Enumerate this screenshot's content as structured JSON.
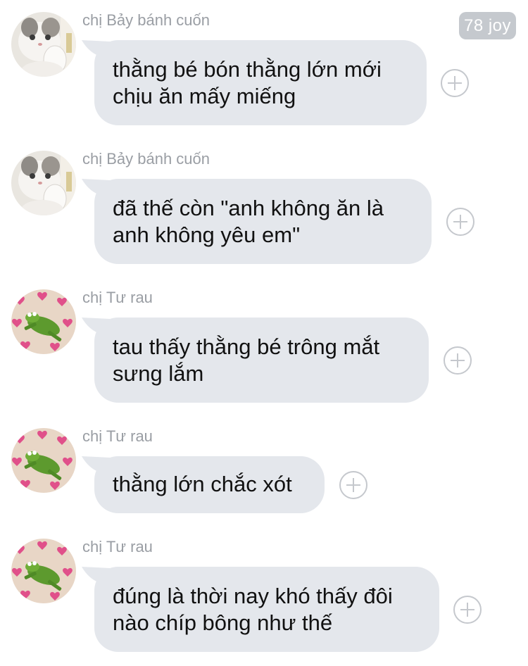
{
  "header": {
    "badge": "78 joy"
  },
  "colors": {
    "bubble": "#e4e7ec",
    "sender": "#9a9ea4",
    "badge": "#c5c9ce",
    "text": "#111111"
  },
  "messages": [
    {
      "sender": "chị Bảy bánh cuốn",
      "avatar": "cat-avatar",
      "lines": [
        "thằng bé bón thằng lớn mới",
        "chịu ăn mấy miếng"
      ]
    },
    {
      "sender": "chị Bảy bánh cuốn",
      "avatar": "cat-avatar",
      "lines": [
        "đã thế còn \"anh không ăn là",
        "anh không yêu em\""
      ]
    },
    {
      "sender": "chị Tư rau",
      "avatar": "frog-hearts-avatar",
      "lines": [
        "tau thấy thằng bé trông mắt",
        "sưng lắm"
      ]
    },
    {
      "sender": "chị Tư rau",
      "avatar": "frog-hearts-avatar",
      "lines": [
        "thằng lớn chắc xót"
      ]
    },
    {
      "sender": "chị Tư rau",
      "avatar": "frog-hearts-avatar",
      "lines": [
        "đúng là thời nay khó thấy đôi",
        "nào chíp bông như thế"
      ]
    }
  ]
}
